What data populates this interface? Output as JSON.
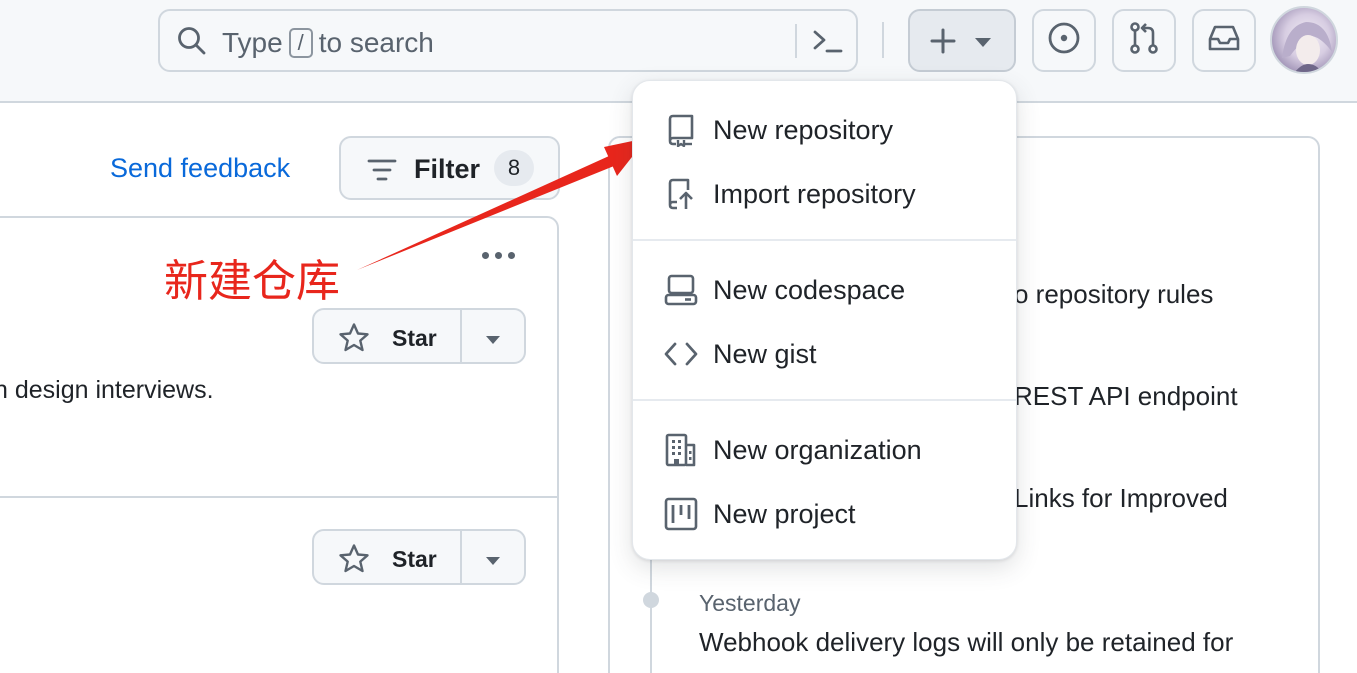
{
  "header": {
    "search_prefix": "Type",
    "search_key": "/",
    "search_suffix": "to search",
    "icons": [
      "search-icon",
      "command-palette-icon",
      "plus-icon",
      "caret-down-icon",
      "issues-icon",
      "pull-requests-icon",
      "inbox-icon"
    ]
  },
  "feed": {
    "send_feedback": "Send feedback",
    "filter_label": "Filter",
    "filter_count": "8",
    "star_label": "Star",
    "repo_description_fragment": "n design interviews."
  },
  "annotation": {
    "text": "新建仓库",
    "color": "#e8261c"
  },
  "create_menu": {
    "items": [
      {
        "label": "New repository",
        "icon": "repo-icon"
      },
      {
        "label": "Import repository",
        "icon": "repo-push-icon"
      },
      {
        "label": "New codespace",
        "icon": "codespaces-icon"
      },
      {
        "label": "New gist",
        "icon": "code-icon"
      },
      {
        "label": "New organization",
        "icon": "organization-icon"
      },
      {
        "label": "New project",
        "icon": "project-icon"
      }
    ]
  },
  "changelog": {
    "fragments": [
      "o repository rules",
      "REST API endpoint",
      "Links for Improved"
    ],
    "date": "Yesterday",
    "entry": "Webhook delivery logs will only be retained for"
  },
  "colors": {
    "link": "#0969da",
    "border": "#d0d7de",
    "header_bg": "#f6f8fa",
    "annotation": "#e8261c"
  }
}
